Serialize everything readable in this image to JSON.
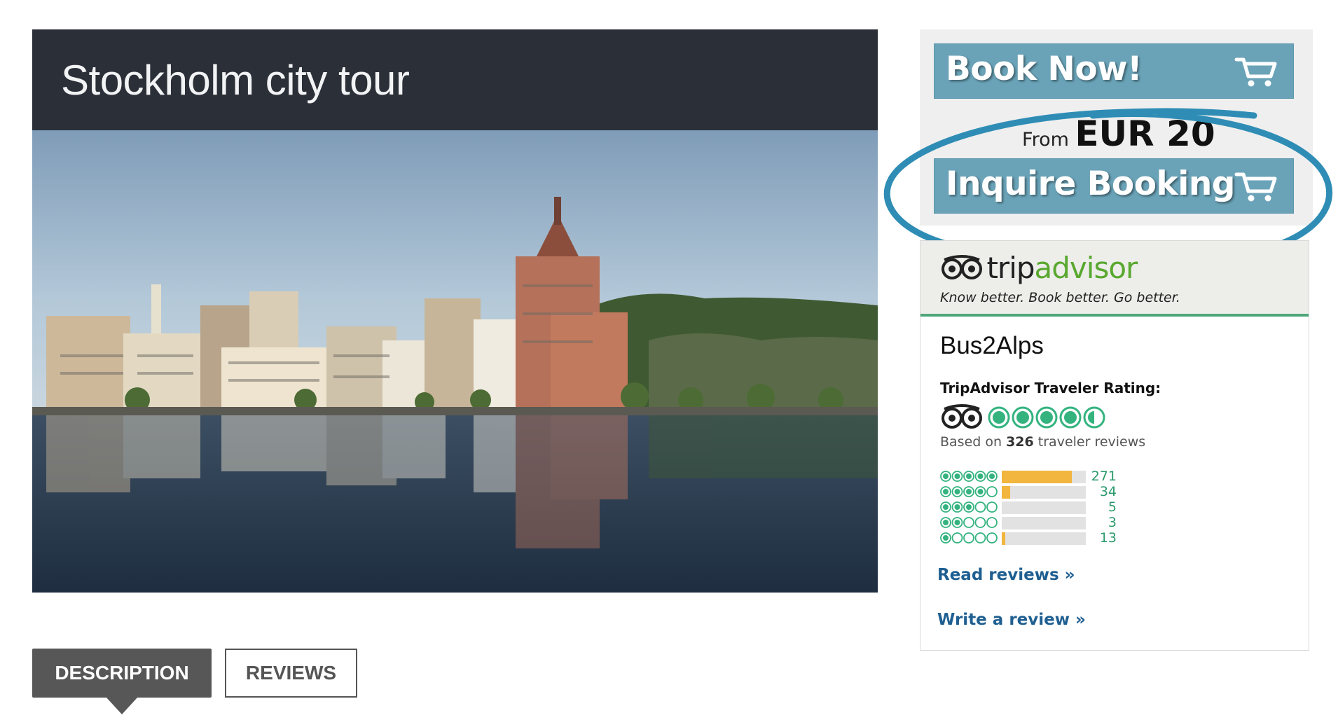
{
  "tour": {
    "title": "Stockholm city tour",
    "photo_alt": "Stockholm waterfront skyline reflected in the water"
  },
  "tabs": [
    {
      "label": "DESCRIPTION",
      "active": true
    },
    {
      "label": "REVIEWS",
      "active": false
    }
  ],
  "booking": {
    "book_now_label": "Book Now!",
    "price_prefix": "From",
    "price_value": "EUR 20",
    "inquire_label": "Inquire Booking",
    "cart_icon": "cart-icon"
  },
  "tripadvisor": {
    "logo_part1": "trip",
    "logo_part2": "advisor",
    "tagline": "Know better. Book better. Go better.",
    "company": "Bus2Alps",
    "rating_title": "TripAdvisor Traveler Rating:",
    "rating": 4.5,
    "based_prefix": "Based on ",
    "review_count": "326",
    "based_suffix": " traveler reviews",
    "distribution": [
      {
        "stars": 5,
        "count": "271",
        "fraction": 0.83
      },
      {
        "stars": 4,
        "count": "34",
        "fraction": 0.1
      },
      {
        "stars": 3,
        "count": "5",
        "fraction": 0.0
      },
      {
        "stars": 2,
        "count": "3",
        "fraction": 0.0
      },
      {
        "stars": 1,
        "count": "13",
        "fraction": 0.04
      }
    ],
    "read_reviews_label": "Read reviews »",
    "write_review_label": "Write a review »",
    "brand_green": "#59a82f",
    "bubble_green": "#34b37f",
    "link_blue": "#1f5f91"
  },
  "colors": {
    "header_bg": "#2b2f37",
    "button_blue": "#6aa3b8",
    "annotation_circle": "#2f8db5",
    "active_tab": "#575757"
  }
}
